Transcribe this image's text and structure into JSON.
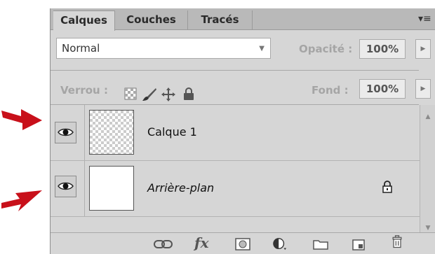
{
  "tabs": [
    {
      "label": "Calques",
      "active": true
    },
    {
      "label": "Couches",
      "active": false
    },
    {
      "label": "Tracés",
      "active": false
    }
  ],
  "panel_menu_icon": "panel-menu-icon",
  "blend_mode": {
    "value": "Normal"
  },
  "opacity": {
    "label": "Opacité :",
    "value": "100%"
  },
  "lock": {
    "label": "Verrou :",
    "icons": [
      "lock-transparency-icon",
      "lock-pixels-icon",
      "lock-position-icon",
      "lock-all-icon"
    ]
  },
  "fill": {
    "label": "Fond :",
    "value": "100%"
  },
  "layers": [
    {
      "name": "Calque 1",
      "visible": true,
      "thumbnail": "transparent",
      "locked": false,
      "italic": false
    },
    {
      "name": "Arrière-plan",
      "visible": true,
      "thumbnail": "white",
      "locked": true,
      "italic": true
    }
  ],
  "bottom_toolbar": [
    "link-layers-icon",
    "fx-icon",
    "layer-mask-icon",
    "adjustment-layer-icon",
    "new-group-icon",
    "new-layer-icon",
    "trash-icon"
  ],
  "bottom_fx_text": "fx",
  "colors": {
    "annotation_arrow": "#c8101a",
    "panel_bg": "#d6d6d6",
    "tab_bar": "#b9b9b9"
  }
}
